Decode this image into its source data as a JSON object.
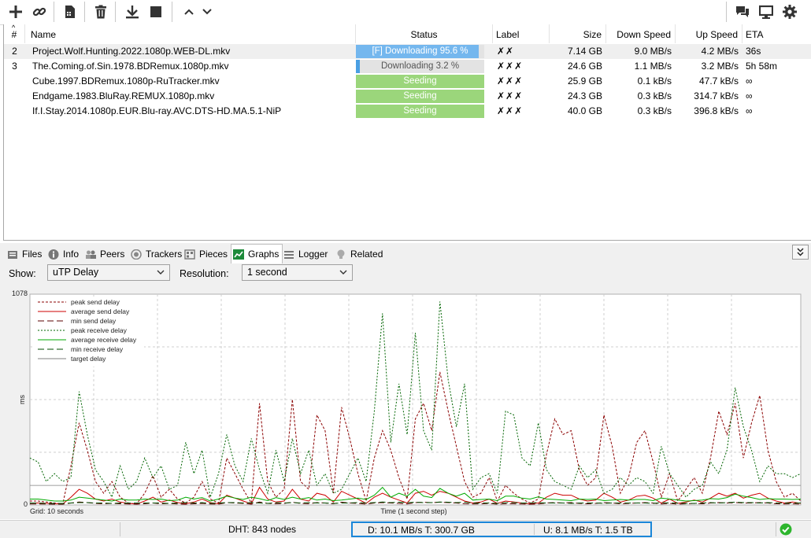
{
  "toolbar": {
    "buttons": [
      {
        "name": "add-torrent-icon"
      },
      {
        "name": "add-url-icon"
      },
      {
        "name": "create-torrent-icon"
      },
      {
        "name": "remove-icon"
      },
      {
        "name": "start-download-icon"
      },
      {
        "name": "stop-icon"
      },
      {
        "name": "move-up-icon"
      },
      {
        "name": "move-down-icon"
      },
      {
        "name": "chat-icon"
      },
      {
        "name": "remote-icon"
      },
      {
        "name": "settings-icon"
      }
    ]
  },
  "list": {
    "columns": {
      "num": "#",
      "name": "Name",
      "status": "Status",
      "label": "Label",
      "size": "Size",
      "down": "Down Speed",
      "up": "Up Speed",
      "eta": "ETA"
    },
    "rows": [
      {
        "num": "2",
        "name": "Project.Wolf.Hunting.2022.1080p.WEB-DL.mkv",
        "status": "[F] Downloading 95.6 %",
        "progress": 95.6,
        "state": "downloading-forced",
        "label": "✗✗",
        "size": "7.14 GB",
        "down": "9.0 MB/s",
        "up": "4.2 MB/s",
        "eta": "36s"
      },
      {
        "num": "3",
        "name": "The.Coming.of.Sin.1978.BDRemux.1080p.mkv",
        "status": "Downloading 3.2 %",
        "progress": 3.2,
        "state": "downloading",
        "label": "✗✗✗",
        "size": "24.6 GB",
        "down": "1.1 MB/s",
        "up": "3.2 MB/s",
        "eta": "5h 58m"
      },
      {
        "num": "",
        "name": "Cube.1997.BDRemux.1080p-RuTracker.mkv",
        "status": "Seeding",
        "progress": 100,
        "state": "seeding",
        "label": "✗✗✗",
        "size": "25.9 GB",
        "down": "0.1 kB/s",
        "up": "47.7 kB/s",
        "eta": "∞"
      },
      {
        "num": "",
        "name": "Endgame.1983.BluRay.REMUX.1080p.mkv",
        "status": "Seeding",
        "progress": 100,
        "state": "seeding",
        "label": "✗✗✗",
        "size": "24.3 GB",
        "down": "0.3 kB/s",
        "up": "314.7 kB/s",
        "eta": "∞"
      },
      {
        "num": "",
        "name": "If.I.Stay.2014.1080p.EUR.Blu-ray.AVC.DTS-HD.MA.5.1-NiP",
        "status": "Seeding",
        "progress": 100,
        "state": "seeding",
        "label": "✗✗✗",
        "size": "40.0 GB",
        "down": "0.3 kB/s",
        "up": "396.8 kB/s",
        "eta": "∞"
      }
    ]
  },
  "tabs": [
    {
      "label": "Files",
      "icon": "files-icon"
    },
    {
      "label": "Info",
      "icon": "info-icon"
    },
    {
      "label": "Peers",
      "icon": "peers-icon"
    },
    {
      "label": "Trackers",
      "icon": "trackers-icon"
    },
    {
      "label": "Pieces",
      "icon": "pieces-icon"
    },
    {
      "label": "Graphs",
      "icon": "graphs-icon",
      "active": true
    },
    {
      "label": "Logger",
      "icon": "logger-icon"
    },
    {
      "label": "Related",
      "icon": "related-icon"
    }
  ],
  "controls": {
    "show_label": "Show:",
    "show_value": "uTP Delay",
    "resolution_label": "Resolution:",
    "resolution_value": "1 second"
  },
  "chart_data": {
    "type": "line",
    "ylabel": "ms",
    "xlabel": "Time (1 second step)",
    "ylim": [
      0,
      1078
    ],
    "y_ticks": [
      "0",
      "1078"
    ],
    "grid_note": "Grid: 10 seconds",
    "legend_position": "top-left",
    "series": [
      {
        "name": "peak send delay",
        "color": "#8b0000",
        "style": "dashed",
        "values": [
          20,
          20,
          15,
          10,
          5,
          200,
          420,
          280,
          120,
          60,
          120,
          40,
          10,
          5,
          60,
          150,
          40,
          80,
          30,
          10,
          40,
          120,
          30,
          10,
          240,
          160,
          80,
          10,
          520,
          120,
          40,
          80,
          540,
          120,
          80,
          460,
          380,
          60,
          500,
          340,
          160,
          20,
          240,
          380,
          280,
          140,
          30,
          440,
          520,
          380,
          680,
          480,
          300,
          120,
          40,
          60,
          140,
          20,
          100,
          60,
          30,
          10,
          30,
          260,
          440,
          360,
          380,
          180,
          100,
          140,
          460,
          300,
          60,
          140,
          320,
          380,
          220,
          40,
          160,
          20,
          80,
          140,
          60,
          240,
          480,
          360,
          520,
          240,
          420,
          560,
          280,
          120,
          40,
          60,
          20
        ]
      },
      {
        "name": "average send delay",
        "color": "#cc0000",
        "style": "solid",
        "values": [
          10,
          10,
          8,
          6,
          5,
          40,
          80,
          60,
          30,
          20,
          30,
          15,
          8,
          5,
          20,
          40,
          15,
          25,
          12,
          6,
          15,
          30,
          12,
          6,
          50,
          35,
          20,
          6,
          90,
          30,
          15,
          20,
          80,
          30,
          20,
          60,
          50,
          15,
          70,
          50,
          30,
          8,
          40,
          60,
          40,
          25,
          10,
          60,
          70,
          50,
          70,
          60,
          40,
          20,
          10,
          15,
          30,
          8,
          20,
          15,
          10,
          6,
          10,
          40,
          60,
          50,
          50,
          30,
          20,
          25,
          60,
          40,
          15,
          25,
          45,
          50,
          35,
          10,
          30,
          8,
          15,
          25,
          15,
          35,
          60,
          45,
          60,
          35,
          50,
          60,
          35,
          20,
          10,
          15,
          8
        ]
      },
      {
        "name": "min send delay",
        "color": "#5a0000",
        "style": "dashdash",
        "values": [
          5,
          5,
          5,
          4,
          4,
          10,
          15,
          12,
          8,
          6,
          8,
          6,
          5,
          4,
          6,
          10,
          6,
          8,
          5,
          4,
          6,
          8,
          5,
          4,
          12,
          10,
          8,
          4,
          15,
          8,
          6,
          8,
          14,
          8,
          6,
          12,
          10,
          6,
          14,
          10,
          8,
          4,
          10,
          12,
          10,
          8,
          5,
          12,
          14,
          12,
          14,
          12,
          10,
          6,
          5,
          6,
          8,
          4,
          6,
          6,
          5,
          4,
          5,
          10,
          12,
          10,
          12,
          8,
          6,
          8,
          12,
          10,
          6,
          8,
          10,
          12,
          10,
          5,
          8,
          4,
          6,
          8,
          6,
          10,
          12,
          10,
          12,
          10,
          10,
          12,
          10,
          6,
          5,
          6,
          4
        ]
      },
      {
        "name": "peak receive delay",
        "color": "#006400",
        "style": "dotted",
        "values": [
          240,
          220,
          120,
          160,
          120,
          140,
          580,
          360,
          180,
          120,
          40,
          200,
          80,
          120,
          240,
          140,
          200,
          80,
          100,
          320,
          160,
          280,
          40,
          160,
          360,
          200,
          120,
          340,
          180,
          60,
          280,
          120,
          340,
          160,
          280,
          100,
          160,
          60,
          80,
          160,
          240,
          120,
          480,
          980,
          320,
          620,
          360,
          880,
          380,
          280,
          1040,
          640,
          400,
          620,
          80,
          140,
          160,
          60,
          480,
          460,
          240,
          200,
          420,
          180,
          120,
          100,
          80,
          200,
          140,
          180,
          60,
          80,
          140,
          100,
          140,
          120,
          60,
          300,
          160,
          100,
          40,
          80,
          100,
          220,
          160,
          280,
          600,
          400,
          280,
          120,
          200,
          160,
          160,
          140,
          160
        ]
      },
      {
        "name": "average receive delay",
        "color": "#00aa00",
        "style": "solid",
        "values": [
          30,
          30,
          25,
          20,
          20,
          25,
          40,
          35,
          30,
          25,
          20,
          30,
          25,
          25,
          30,
          28,
          30,
          22,
          25,
          40,
          30,
          38,
          20,
          30,
          45,
          35,
          28,
          40,
          32,
          22,
          38,
          28,
          40,
          30,
          38,
          25,
          30,
          22,
          25,
          30,
          35,
          28,
          50,
          90,
          40,
          60,
          45,
          80,
          45,
          38,
          85,
          60,
          45,
          60,
          25,
          28,
          30,
          22,
          45,
          45,
          35,
          30,
          42,
          30,
          28,
          25,
          22,
          30,
          28,
          30,
          22,
          25,
          28,
          25,
          28,
          28,
          22,
          35,
          30,
          25,
          20,
          22,
          25,
          32,
          30,
          38,
          55,
          45,
          38,
          28,
          32,
          30,
          30,
          28,
          30
        ]
      },
      {
        "name": "min receive delay",
        "color": "#004d00",
        "style": "dashdash",
        "values": [
          10,
          10,
          8,
          8,
          8,
          10,
          12,
          12,
          10,
          10,
          8,
          10,
          10,
          10,
          10,
          10,
          10,
          8,
          10,
          12,
          10,
          12,
          8,
          10,
          12,
          12,
          10,
          12,
          10,
          8,
          12,
          10,
          12,
          10,
          12,
          10,
          10,
          8,
          10,
          10,
          12,
          10,
          12,
          15,
          12,
          14,
          12,
          14,
          12,
          12,
          15,
          14,
          12,
          14,
          10,
          10,
          10,
          8,
          12,
          12,
          10,
          10,
          12,
          10,
          10,
          10,
          8,
          10,
          10,
          10,
          8,
          10,
          10,
          10,
          10,
          10,
          8,
          12,
          10,
          10,
          8,
          8,
          10,
          12,
          10,
          12,
          14,
          12,
          12,
          10,
          12,
          10,
          10,
          10,
          10
        ]
      },
      {
        "name": "target delay",
        "color": "#808080",
        "style": "solid",
        "values": [
          100,
          100,
          100,
          100,
          100,
          100,
          100,
          100,
          100,
          100,
          100,
          100,
          100,
          100,
          100,
          100,
          100,
          100,
          100,
          100,
          100,
          100,
          100,
          100,
          100,
          100,
          100,
          100,
          100,
          100,
          100,
          100,
          100,
          100,
          100,
          100,
          100,
          100,
          100,
          100,
          100,
          100,
          100,
          100,
          100,
          100,
          100,
          100,
          100,
          100,
          100,
          100,
          100,
          100,
          100,
          100,
          100,
          100,
          100,
          100,
          100,
          100,
          100,
          100,
          100,
          100,
          100,
          100,
          100,
          100,
          100,
          100,
          100,
          100,
          100,
          100,
          100,
          100,
          100,
          100,
          100,
          100,
          100,
          100,
          100,
          100,
          100,
          100,
          100,
          100,
          100,
          100,
          100,
          100,
          100
        ]
      }
    ]
  },
  "status": {
    "dht": "DHT: 843 nodes",
    "down": "D: 10.1 MB/s T: 300.7 GB",
    "up": "U: 8.1 MB/s T: 1.5 TB",
    "connection_icon": "status-ok-icon",
    "accent": "#1a86d8"
  }
}
